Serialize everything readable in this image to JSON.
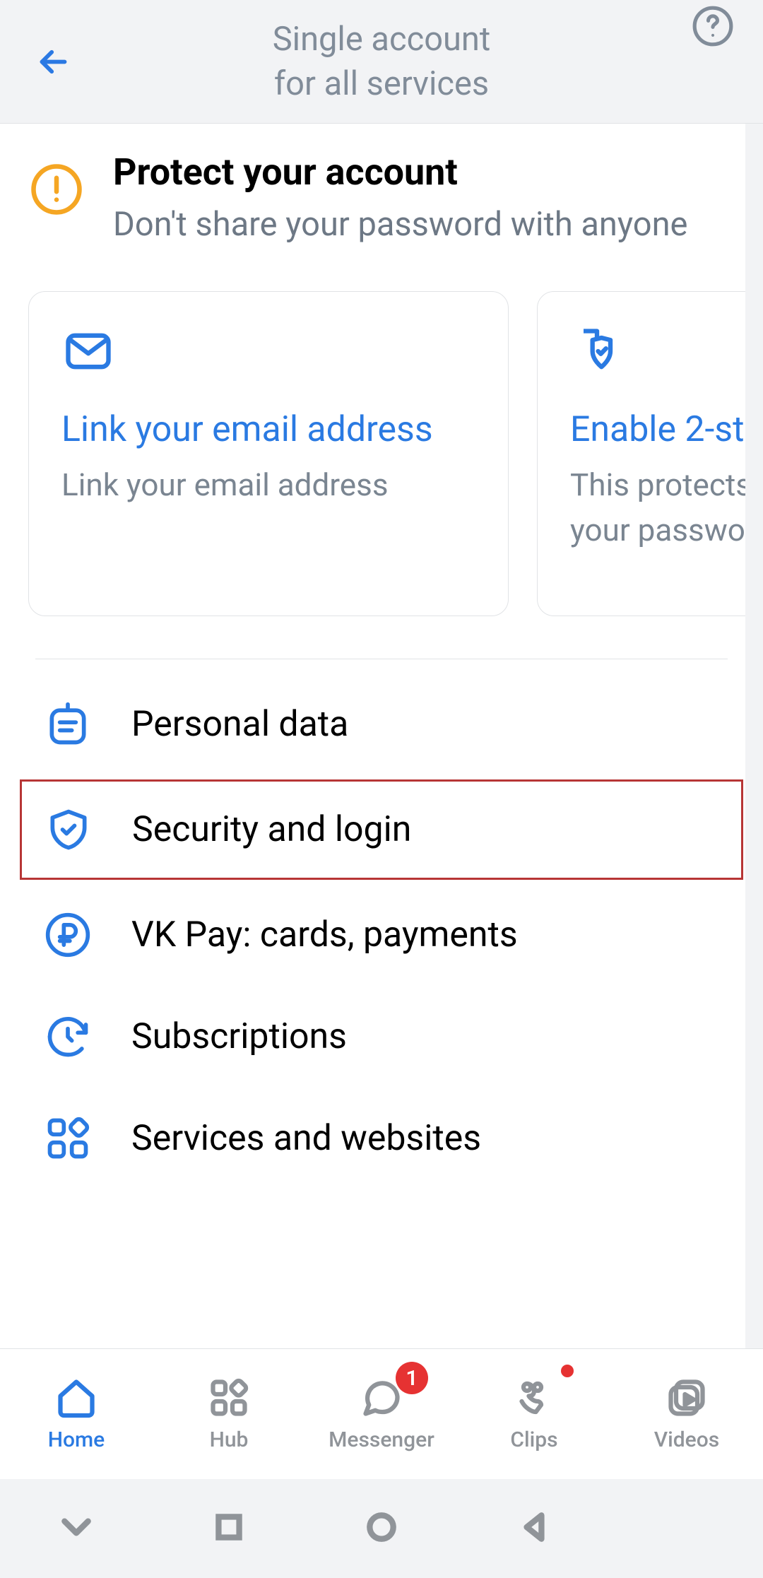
{
  "header": {
    "title_line1": "Single account",
    "title_line2": "for all services"
  },
  "alert": {
    "heading": "Protect your account",
    "body": "Don't share your password with anyone"
  },
  "cards": [
    {
      "title": "Link your email address",
      "subtitle": "Link your email address"
    },
    {
      "title": "Enable 2-st",
      "subtitle": "This protects if someone g your passwor"
    }
  ],
  "menu": [
    {
      "label": "Personal data"
    },
    {
      "label": "Security and login"
    },
    {
      "label": "VK Pay: cards, payments"
    },
    {
      "label": "Subscriptions"
    },
    {
      "label": "Services and websites"
    }
  ],
  "nav": {
    "home": "Home",
    "hub": "Hub",
    "messenger": "Messenger",
    "messenger_badge": "1",
    "clips": "Clips",
    "videos": "Videos"
  },
  "colors": {
    "accent": "#2a7ae2",
    "muted": "#818c99",
    "warn": "#f5a623"
  }
}
